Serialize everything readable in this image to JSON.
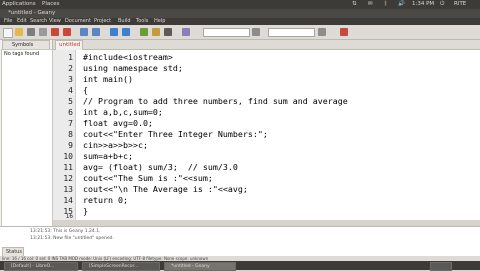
{
  "top_panel": {
    "applications": "Applications",
    "places": "Places",
    "time": "1:34 PM",
    "user": "RITE"
  },
  "window": {
    "title": "*untitled - Geany"
  },
  "menu": [
    "File",
    "Edit",
    "Search",
    "View",
    "Document",
    "Project",
    "Build",
    "Tools",
    "Help"
  ],
  "sidebar": {
    "tab_label": "Symbols",
    "empty_message": "No tags found"
  },
  "editor": {
    "tab_label": "untitled",
    "lines": [
      {
        "n": "1",
        "text": "#include<iostream>"
      },
      {
        "n": "2",
        "text": "using namespace std;"
      },
      {
        "n": "3",
        "text": "int main()"
      },
      {
        "n": "4",
        "text": "{"
      },
      {
        "n": "5",
        "text": "// Program to add three numbers, find sum and average"
      },
      {
        "n": "6",
        "text": "int a,b,c,sum=0;"
      },
      {
        "n": "7",
        "text": "float avg=0.0;"
      },
      {
        "n": "8",
        "text": "cout<<\"Enter Three Integer Numbers:\";"
      },
      {
        "n": "9",
        "text": "cin>>a>>b>>c;"
      },
      {
        "n": "10",
        "text": "sum=a+b+c;"
      },
      {
        "n": "11",
        "text": "avg= (float) sum/3;  // sum/3.0"
      },
      {
        "n": "12",
        "text": "cout<<\"The Sum is :\"<<sum;"
      },
      {
        "n": "13",
        "text": "cout<<\"\\n The Average is :\"<<avg;"
      },
      {
        "n": "14",
        "text": "return 0;"
      },
      {
        "n": "15",
        "text": "}"
      },
      {
        "n": "16",
        "text": ""
      }
    ]
  },
  "messages": {
    "line1": "13:21:53: This is Geany 1.24.1.",
    "line2": "13:21:53: New file \"untitled\" opened.",
    "status_tab": "Status"
  },
  "status_bar": "line: 16 / 16   col: 0   sel: 0   INS   TAB   MOD   mode: Unix (LF)   encoding: UTF-8   filetype: None   scope: unknown",
  "taskbar": [
    {
      "label": "[Default] - LibreO..."
    },
    {
      "label": "[SimpleScreenRecor..."
    },
    {
      "label": "*untitled - Geany"
    }
  ],
  "colors": {
    "panel": "#3c3b37",
    "tab_text": "#c0392b",
    "gutter": "#ebebeb"
  }
}
